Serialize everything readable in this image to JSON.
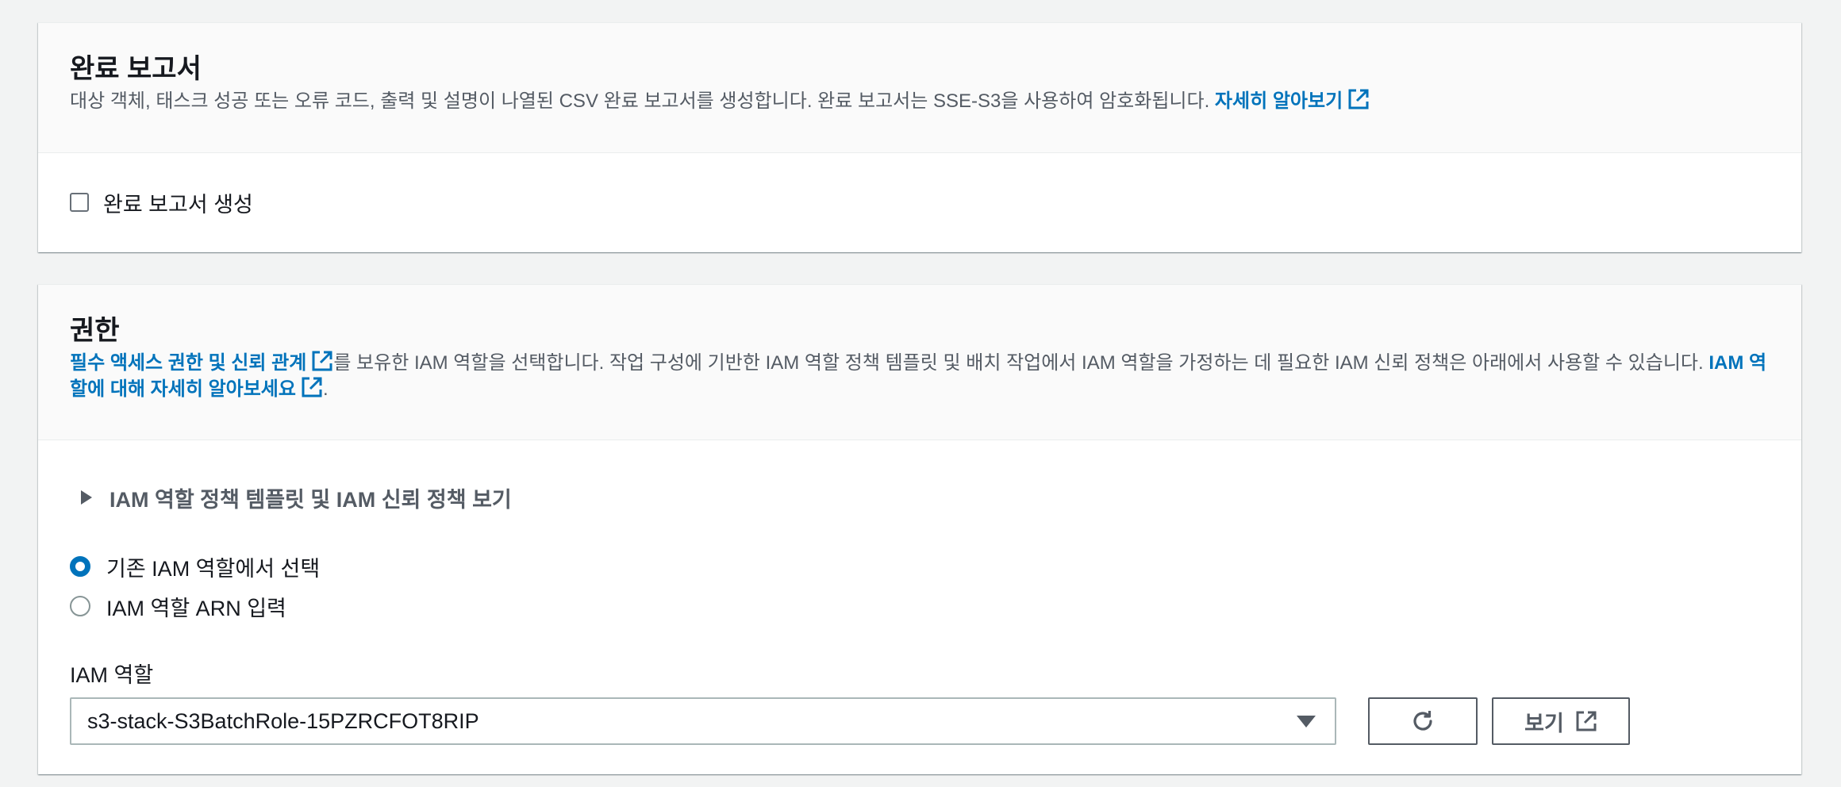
{
  "report": {
    "title": "완료 보고서",
    "description": "대상 객체, 태스크 성공 또는 오류 코드, 출력 및 설명이 나열된 CSV 완료 보고서를 생성합니다. 완료 보고서는 SSE-S3을 사용하여 암호화됩니다. ",
    "learn_more": "자세히 알아보기",
    "checkbox_label": "완료 보고서 생성",
    "checkbox_checked": false
  },
  "permissions": {
    "title": "권한",
    "desc_link1": "필수 액세스 권한 및 신뢰 관계",
    "desc_text": "를 보유한 IAM 역할을 선택합니다. 작업 구성에 기반한 IAM 역할 정책 템플릿 및 배치 작업에서 IAM 역할을 가정하는 데 필요한 IAM 신뢰 정책은 아래에서 사용할 수 있습니다. ",
    "desc_link2": "IAM 역할에 대해 자세히 알아보세요",
    "desc_end": ".",
    "expander_label": "IAM 역할 정책 템플릿 및 IAM 신뢰 정책 보기",
    "radio_options": [
      {
        "label": "기존 IAM 역할에서 선택",
        "checked": true
      },
      {
        "label": "IAM 역할 ARN 입력",
        "checked": false
      }
    ],
    "field_label": "IAM 역할",
    "selected_role": "s3-stack-S3BatchRole-15PZRCFOT8RIP",
    "view_button": "보기"
  },
  "colors": {
    "link": "#0073bb",
    "background": "#f2f3f3",
    "header_bg": "#fafafa",
    "text_secondary": "#545b64"
  },
  "icons": [
    "external-link-icon",
    "refresh-icon",
    "caret-right-icon",
    "caret-down-icon"
  ]
}
